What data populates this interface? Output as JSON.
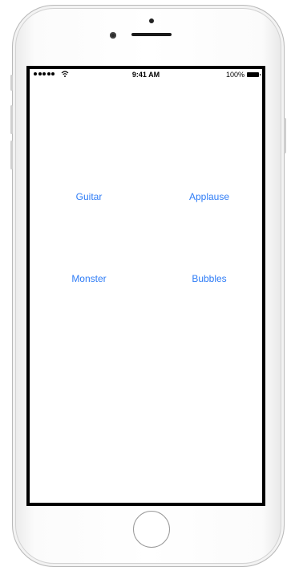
{
  "status_bar": {
    "time": "9:41 AM",
    "battery_percent": "100%",
    "signal_icon": "signal-dots-icon",
    "wifi_icon": "wifi-icon",
    "battery_icon": "battery-icon"
  },
  "buttons": {
    "guitar": "Guitar",
    "applause": "Applause",
    "monster": "Monster",
    "bubbles": "Bubbles"
  },
  "colors": {
    "accent": "#2e7cf6",
    "screen_background": "#ffffff",
    "bezel": "#000000"
  }
}
